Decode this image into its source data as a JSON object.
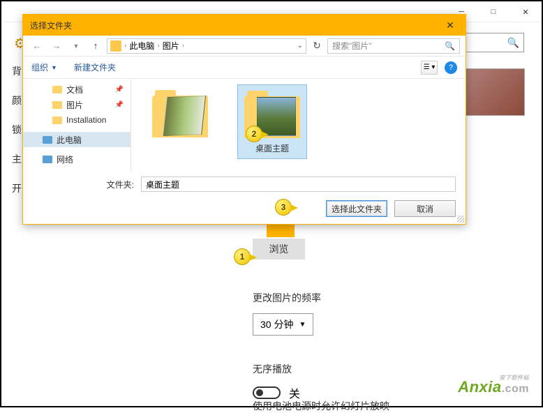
{
  "bgwindow": {
    "sidebar": [
      "背",
      "颜",
      "锁",
      "主",
      "开"
    ],
    "browse_label": "浏览",
    "freq_label": "更改图片的频率",
    "freq_value": "30 分钟",
    "shuffle_label": "无序播放",
    "shuffle_state": "关",
    "cutoff_text": "使用电池电源时允许幻灯片放映"
  },
  "dialog": {
    "title": "选择文件夹",
    "breadcrumb": {
      "item1": "此电脑",
      "item2": "图片"
    },
    "search_placeholder": "搜索\"图片\"",
    "toolbar": {
      "organize": "组织",
      "newfolder": "新建文件夹"
    },
    "tree": [
      {
        "label": "文档",
        "pin": true
      },
      {
        "label": "图片",
        "pin": true
      },
      {
        "label": "Installation"
      },
      {
        "label": "此电脑",
        "selected": true,
        "pc": true
      },
      {
        "label": "网络",
        "partial": true
      }
    ],
    "files": [
      {
        "name": ""
      },
      {
        "name": "桌面主题",
        "selected": true
      }
    ],
    "folder_label": "文件夹:",
    "folder_value": "桌面主题",
    "select_btn": "选择此文件夹",
    "cancel_btn": "取消"
  },
  "callouts": {
    "c1": "1",
    "c2": "2",
    "c3": "3"
  },
  "watermark": {
    "brand": "Anxia",
    "suffix": ".com",
    "sub": "安下软件站"
  }
}
